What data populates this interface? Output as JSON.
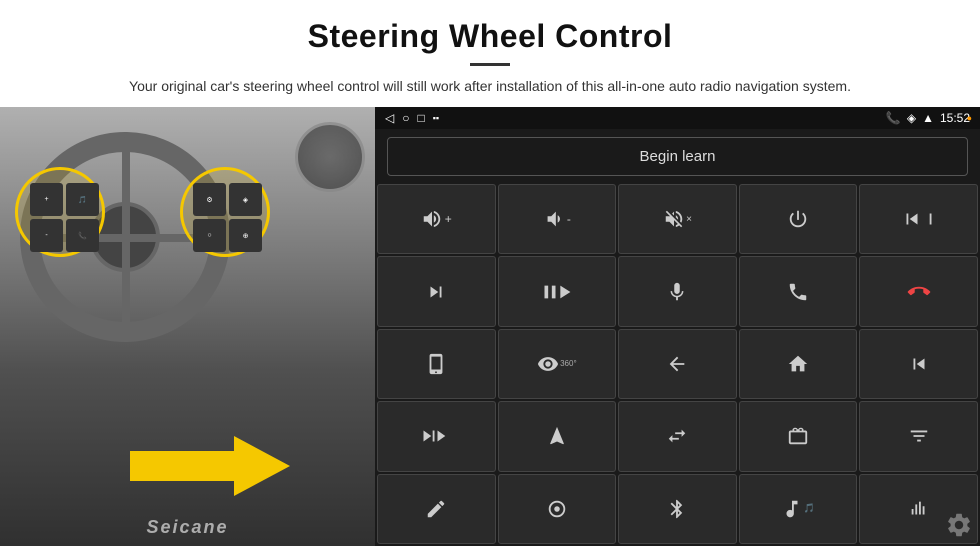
{
  "header": {
    "title": "Steering Wheel Control",
    "subtitle": "Your original car's steering wheel control will still work after installation of this all-in-one auto radio navigation system."
  },
  "statusBar": {
    "leftIcons": [
      "◁",
      "○",
      "□",
      "▪▪"
    ],
    "time": "15:52",
    "rightIcons": [
      "📞",
      "◈",
      "WiFi"
    ]
  },
  "beginLearnButton": {
    "label": "Begin learn"
  },
  "navBar": {
    "back": "◁",
    "home": "○",
    "recents": "□",
    "signal": "▪▪"
  },
  "controls": [
    {
      "icon": "🔊+",
      "label": "vol-up"
    },
    {
      "icon": "🔊-",
      "label": "vol-down"
    },
    {
      "icon": "🔇",
      "label": "mute"
    },
    {
      "icon": "⏻",
      "label": "power"
    },
    {
      "icon": "⏮",
      "label": "prev-track"
    },
    {
      "icon": "⏭",
      "label": "next"
    },
    {
      "icon": "⏯",
      "label": "play-pause"
    },
    {
      "icon": "🎤",
      "label": "mic"
    },
    {
      "icon": "📞",
      "label": "call"
    },
    {
      "icon": "📞",
      "label": "hang-up"
    },
    {
      "icon": "📱",
      "label": "source"
    },
    {
      "icon": "👁",
      "label": "360-cam"
    },
    {
      "icon": "↩",
      "label": "back"
    },
    {
      "icon": "🏠",
      "label": "home"
    },
    {
      "icon": "⏮",
      "label": "rewind"
    },
    {
      "icon": "⏭",
      "label": "fast-forward"
    },
    {
      "icon": "🧭",
      "label": "nav"
    },
    {
      "icon": "⇄",
      "label": "switch"
    },
    {
      "icon": "📻",
      "label": "radio"
    },
    {
      "icon": "🎛",
      "label": "eq"
    },
    {
      "icon": "✏",
      "label": "edit"
    },
    {
      "icon": "⏺",
      "label": "record"
    },
    {
      "icon": "🎵",
      "label": "bluetooth"
    },
    {
      "icon": "♫",
      "label": "music"
    },
    {
      "icon": "📊",
      "label": "spectrum"
    }
  ],
  "seicane": {
    "brand": "Seicane"
  },
  "settings": {
    "icon": "⚙"
  }
}
